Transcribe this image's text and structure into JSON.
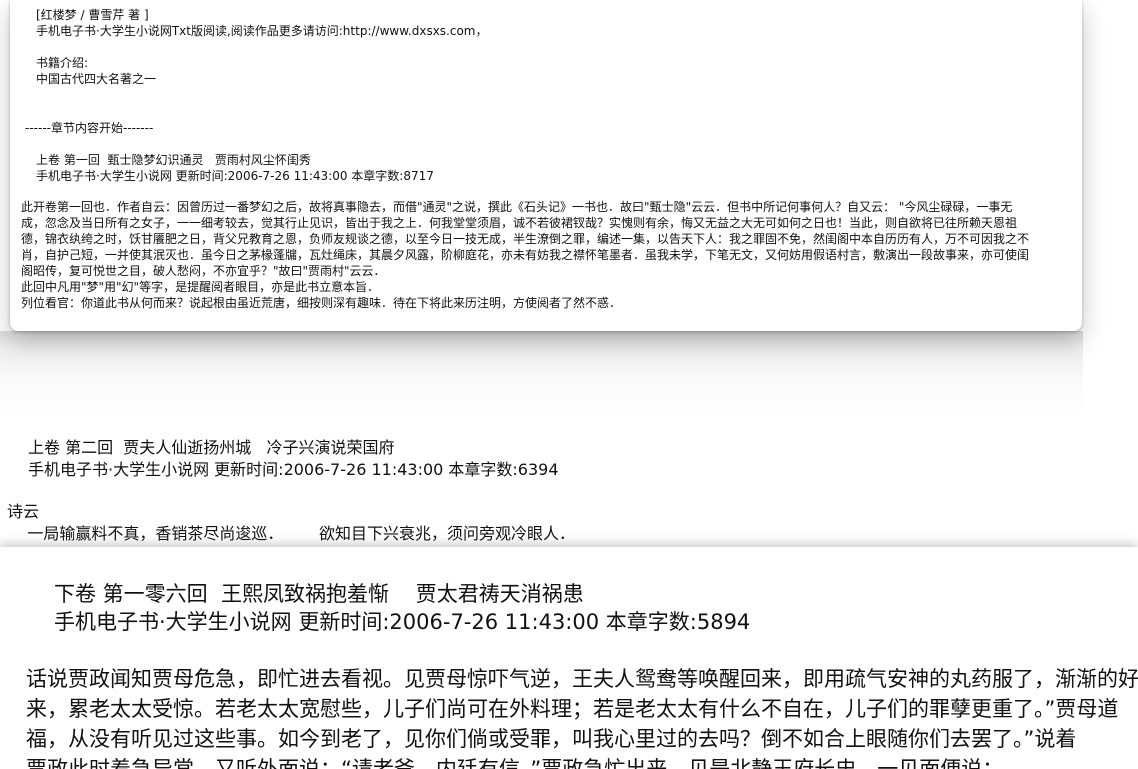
{
  "window1": {
    "header_line": "[红楼梦 / 曹雪芹 著 ]",
    "source_line": "手机电子书·大学生小说网Txt版阅读,阅读作品更多请访问:http://www.dxsxs.com，",
    "intro_label": "书籍介绍:",
    "intro_text": "中国古代四大名著之一",
    "chapter_start": "------章节内容开始-------",
    "chapter_title": "上卷 第一回  甄士隐梦幻识通灵   贾雨村风尘怀闺秀",
    "chapter_meta": "手机电子书·大学生小说网 更新时间:2006-7-26 11:43:00 本章字数:8717",
    "body_lines": [
      "此开卷第一回也．作者自云：因曾历过一番梦幻之后，故将真事隐去，而借\"通灵\"之说，撰此《石头记》一书也．故曰\"甄士隐\"云云．但书中所记何事何人？自又云：  \"今风尘碌碌，一事无",
      "成，忽念及当日所有之女子，一一细考较去，觉其行止见识，皆出于我之上．何我堂堂须眉，诚不若彼裙钗哉？实愧则有余，悔又无益之大无可如何之日也！当此，则自欲将已往所赖天恩祖",
      "德，锦衣纨绔之时，饫甘餍肥之日，背父兄教育之恩，负师友规谈之德，以至今日一技无成，半生潦倒之罪，编述一集，以告天下人：我之罪固不免，然闺阁中本自历历有人，万不可因我之不",
      "肖，自护己短，一并使其泯灭也．虽今日之茅椽蓬牖，瓦灶绳床，其晨夕风露，阶柳庭花，亦未有妨我之襟怀笔墨者．虽我未学，下笔无文，又何妨用假语村言，敷演出一段故事来，亦可使闺",
      "阁昭传，复可悦世之目，破人愁闷，不亦宜乎？\"故曰\"贾雨村\"云云．",
      "    此回中凡用\"梦\"用\"幻\"等字，是提醒阅者眼目，亦是此书立意本旨．",
      "    列位看官：你道此书从何而来？说起根由虽近荒唐，细按则深有趣味．待在下将此来历注明，方使阅者了然不惑．"
    ]
  },
  "window2": {
    "chapter_title": "上卷 第二回  贾夫人仙逝扬州城   冷子兴演说荣国府",
    "chapter_meta": "手机电子书·大学生小说网 更新时间:2006-7-26 11:43:00 本章字数:6394",
    "poem_label": "诗云",
    "poem_line": "    一局输赢料不真，香销茶尽尚逡巡．       欲知目下兴衰兆，须问旁观冷眼人．"
  },
  "window3": {
    "chapter_title": "下卷 第一零六回  王熙凤致祸抱羞惭    贾太君祷天消祸患",
    "chapter_meta": "手机电子书·大学生小说网 更新时间:2006-7-26 11:43:00 本章字数:5894",
    "body_lines": [
      "话说贾政闻知贾母危急，即忙进去看视。见贾母惊吓气逆，王夫人鸳鸯等唤醒回来，即用疏气安神的丸药服了，渐渐的好些",
      "来，累老太太受惊。若老太太宽慰些，儿子们尚可在外料理；若是老太太有什么不自在，儿子们的罪孽更重了。”贾母道",
      "福，从没有听见过这些事。如今到老了，见你们倘或受罪，叫我心里过的去吗？倒不如合上眼随你们去罢了。”说着",
      "    贾政此时着急异常，又听外面说：“请老爷，内廷有信。”贾政急忙出来，见是北静王府长史，一见面便说："
    ]
  }
}
